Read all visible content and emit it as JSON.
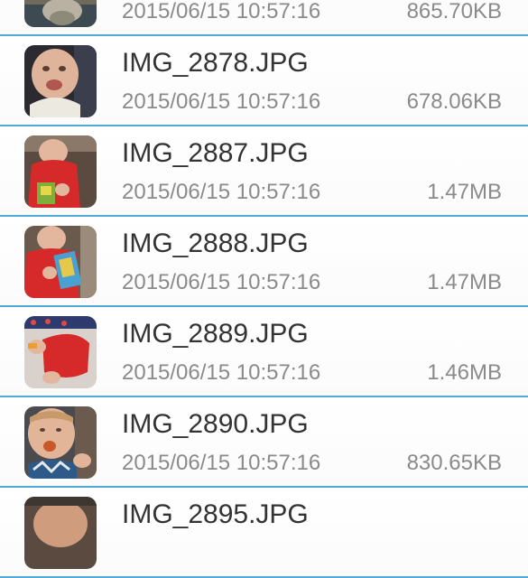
{
  "files": [
    {
      "name": "",
      "date": "2015/06/15 10:57:16",
      "size": "865.70KB",
      "thumbnail_icon": "photo-thumbnail-icon"
    },
    {
      "name": "IMG_2878.JPG",
      "date": "2015/06/15 10:57:16",
      "size": "678.06KB",
      "thumbnail_icon": "photo-thumbnail-icon"
    },
    {
      "name": "IMG_2887.JPG",
      "date": "2015/06/15 10:57:16",
      "size": "1.47MB",
      "thumbnail_icon": "photo-thumbnail-icon"
    },
    {
      "name": "IMG_2888.JPG",
      "date": "2015/06/15 10:57:16",
      "size": "1.47MB",
      "thumbnail_icon": "photo-thumbnail-icon"
    },
    {
      "name": "IMG_2889.JPG",
      "date": "2015/06/15 10:57:16",
      "size": "1.46MB",
      "thumbnail_icon": "photo-thumbnail-icon"
    },
    {
      "name": "IMG_2890.JPG",
      "date": "2015/06/15 10:57:16",
      "size": "830.65KB",
      "thumbnail_icon": "photo-thumbnail-icon"
    },
    {
      "name": "IMG_2895.JPG",
      "date": "",
      "size": "",
      "thumbnail_icon": "photo-thumbnail-icon"
    }
  ],
  "colors": {
    "separator": "#4fa8d6",
    "name_text": "#333333",
    "meta_text": "#8a8a8a"
  }
}
